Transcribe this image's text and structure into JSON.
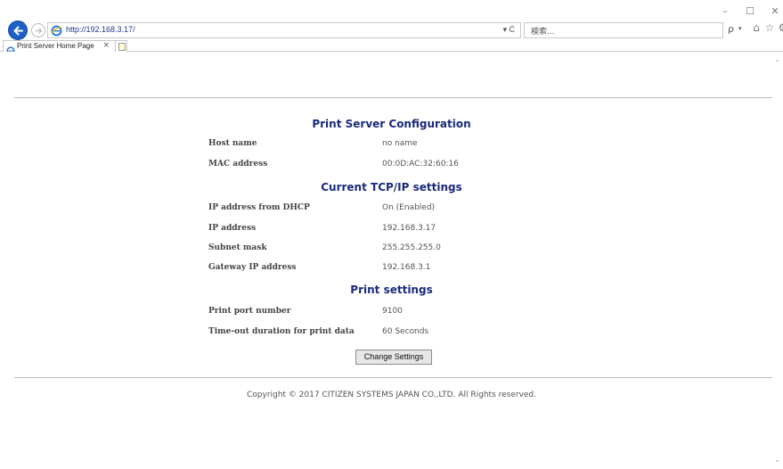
{
  "browser": {
    "url": "http://192.168.3.17/",
    "search_placeholder": "検索...",
    "tab_title": "Print Server Home Page",
    "reload_glyph": "▾ Ċ",
    "search_icon": "ρ",
    "window_controls": [
      "–",
      "☐",
      "✕"
    ],
    "toolbar_icons": [
      "home-icon",
      "favorites-star-icon",
      "settings-gear-icon",
      "feedback-smiley-icon"
    ]
  },
  "page": {
    "sections": [
      {
        "title": "Print Server Configuration",
        "rows": [
          {
            "label": "Host name",
            "value": "no name"
          },
          {
            "label": "MAC address",
            "value": "00:0D:AC:32:60:16"
          }
        ]
      },
      {
        "title": "Current TCP/IP settings",
        "rows": [
          {
            "label": "IP address from DHCP",
            "value": "On (Enabled)"
          },
          {
            "label": "IP address",
            "value": "192.168.3.17"
          },
          {
            "label": "Subnet mask",
            "value": "255.255.255.0"
          },
          {
            "label": "Gateway IP address",
            "value": "192.168.3.1"
          }
        ]
      },
      {
        "title": "Print settings",
        "rows": [
          {
            "label": "Print port number",
            "value": "9100"
          },
          {
            "label": "Time-out duration for print data",
            "value": "60 Seconds"
          }
        ]
      }
    ],
    "change_button": "Change Settings",
    "copyright": "Copyright © 2017 CITIZEN SYSTEMS JAPAN CO.,LTD. All Rights reserved."
  },
  "colors": {
    "heading": "#1a2a7c",
    "back_button": "#1e61c6"
  }
}
